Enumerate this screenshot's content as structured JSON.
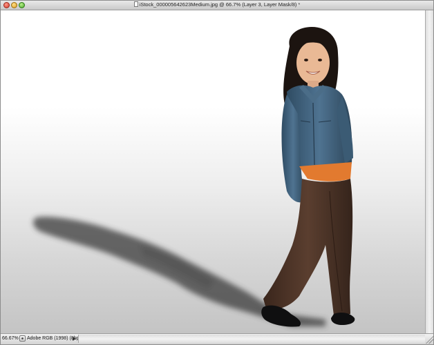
{
  "window": {
    "title": "iStock_000005642623Medium.jpg @ 66.7% (Layer 3, Layer Mask/8)",
    "title_suffix": "*"
  },
  "status_bar": {
    "zoom": "66.67%",
    "document_info": "Adobe RGB (1998) (8bpc)"
  },
  "colors": {
    "jacket": "#3e5f78",
    "pants": "#4a3226",
    "shirt": "#e27a2f",
    "hair": "#1c1410",
    "skin": "#e9b995",
    "shadow": "#3a3a3a"
  },
  "icons": [
    "close-button",
    "minimize-button",
    "zoom-button",
    "document-icon",
    "status-info-icon",
    "status-menu-arrow",
    "resize-grip"
  ]
}
